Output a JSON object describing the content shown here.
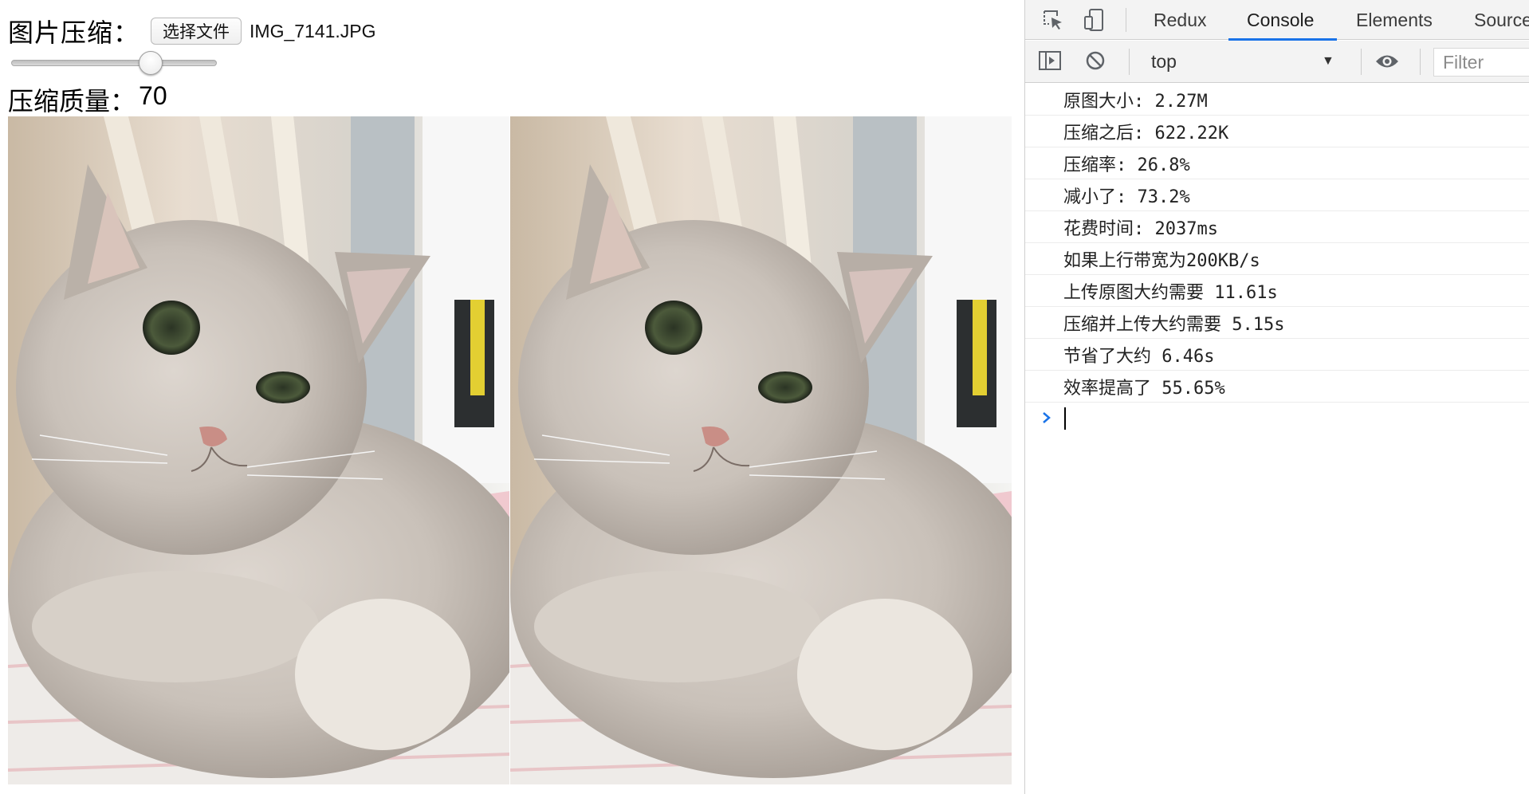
{
  "page": {
    "upload_label": "图片压缩：",
    "file_button_label": "选择文件",
    "file_name": "IMG_7141.JPG",
    "quality_slider_value": 70,
    "quality_label": "压缩质量：",
    "quality_value": "70"
  },
  "devtools": {
    "tabs": [
      {
        "label": "Redux",
        "active": false
      },
      {
        "label": "Console",
        "active": true
      },
      {
        "label": "Elements",
        "active": false
      },
      {
        "label": "Source",
        "active": false
      }
    ],
    "icons": [
      "inspect-element-icon",
      "device-toolbar-icon",
      "sidebar-toggle-icon",
      "clear-console-icon",
      "eye-icon",
      "prompt-chevron-icon"
    ],
    "context": "top",
    "filter_placeholder": "Filter",
    "accent_color": "#1a73e8",
    "logs": [
      "原图大小: 2.27M",
      "压缩之后: 622.22K",
      "压缩率: 26.8%",
      "减小了: 73.2%",
      "花费时间: 2037ms",
      "如果上行带宽为200KB/s",
      "上传原图大约需要 11.61s",
      "压缩并上传大约需要 5.15s",
      "节省了大约 6.46s",
      "效率提高了 55.65%"
    ]
  }
}
